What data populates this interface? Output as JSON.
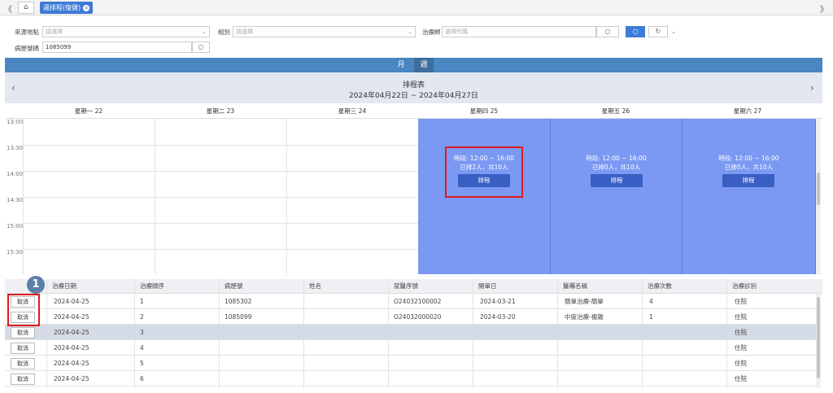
{
  "topbar": {
    "left_arrow": "《",
    "right_arrow": "》",
    "home_icon": "⌂",
    "active_tab": "週排程(復健)",
    "close_glyph": "×"
  },
  "filters": {
    "source_label": "來源地點",
    "source_placeholder": "請選擇",
    "group_label": "組別",
    "group_placeholder": "請選擇",
    "therapist_label": "治療師",
    "therapist_placeholder": "選擇代碼",
    "chart_label": "病歷號碼",
    "chart_value": "1085099",
    "search_glyph": "○",
    "refresh_glyph": "↻",
    "more_glyph": "⌄"
  },
  "calendar": {
    "view_month": "月",
    "view_week": "週",
    "title": "排程表",
    "range": "2024年04月22日 ~ 2024年04月27日",
    "prev_glyph": "‹",
    "next_glyph": "›",
    "days": [
      "星期一 22",
      "星期二 23",
      "星期三 24",
      "星期四 25",
      "星期五 26",
      "星期六 27"
    ],
    "times": [
      "13:00",
      "13:30",
      "14:00",
      "14:30",
      "15:00",
      "15:30"
    ],
    "slots": [
      {
        "day": "星期四 25",
        "period": "時段: 12:00 ~ 16:00",
        "count": "已排2人，共10人",
        "button": "排程"
      },
      {
        "day": "星期五 26",
        "period": "時段: 12:00 ~ 16:00",
        "count": "已排0人，共10人",
        "button": "排程"
      },
      {
        "day": "星期六 27",
        "period": "時段: 12:00 ~ 16:00",
        "count": "已排0人，共10人",
        "button": "排程"
      }
    ]
  },
  "table": {
    "badge": "1",
    "headers": [
      "治療日期",
      "治療順序",
      "病歷號",
      "姓名",
      "就醫序號",
      "開單日",
      "醫囑名稱",
      "治療次數",
      "治療診別"
    ],
    "cancel_label": "取消",
    "rows": [
      {
        "date": "2024-04-25",
        "order": "1",
        "chart": "1085302",
        "name": "",
        "visit": "O24032100002",
        "open": "2024-03-21",
        "rx": "簡單治療-簡單",
        "times": "4",
        "type": "住院"
      },
      {
        "date": "2024-04-25",
        "order": "2",
        "chart": "1085099",
        "name": "",
        "visit": "O24032000020",
        "open": "2024-03-20",
        "rx": "中度治療-複雜",
        "times": "1",
        "type": "住院"
      },
      {
        "date": "2024-04-25",
        "order": "3",
        "chart": "",
        "name": "",
        "visit": "",
        "open": "",
        "rx": "",
        "times": "",
        "type": "住院"
      },
      {
        "date": "2024-04-25",
        "order": "4",
        "chart": "",
        "name": "",
        "visit": "",
        "open": "",
        "rx": "",
        "times": "",
        "type": "住院"
      },
      {
        "date": "2024-04-25",
        "order": "5",
        "chart": "",
        "name": "",
        "visit": "",
        "open": "",
        "rx": "",
        "times": "",
        "type": "住院"
      },
      {
        "date": "2024-04-25",
        "order": "6",
        "chart": "",
        "name": "",
        "visit": "",
        "open": "",
        "rx": "",
        "times": "",
        "type": "住院"
      }
    ]
  }
}
